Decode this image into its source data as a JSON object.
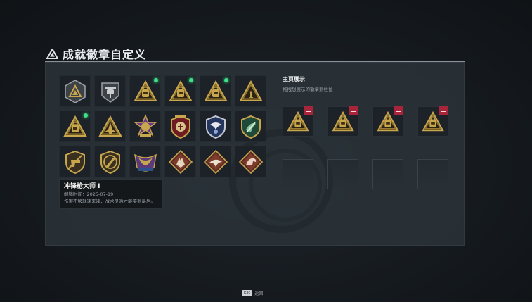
{
  "header": {
    "title": "成就徽章自定义"
  },
  "badges": [
    {
      "icon": "hexagon-triangle-badge-icon",
      "new": false
    },
    {
      "icon": "helicopter-badge-icon",
      "new": false
    },
    {
      "icon": "backpack-badge-icon",
      "new": true
    },
    {
      "icon": "backpack-badge-icon",
      "new": true
    },
    {
      "icon": "backpack-badge-icon",
      "new": true
    },
    {
      "icon": "number-one-badge-icon",
      "new": false
    },
    {
      "icon": "backpack-badge-icon",
      "new": true
    },
    {
      "icon": "fighter-jet-badge-icon",
      "new": false
    },
    {
      "icon": "star-cross-crest-icon",
      "new": false
    },
    {
      "icon": "red-shield-crest-icon",
      "new": false
    },
    {
      "icon": "blue-eagle-crest-icon",
      "new": false
    },
    {
      "icon": "green-shield-crest-icon",
      "new": false
    },
    {
      "icon": "no-pistol-shield-icon",
      "new": false
    },
    {
      "icon": "no-knife-shield-icon",
      "new": false
    },
    {
      "icon": "eagle-wings-crest-icon",
      "new": false
    },
    {
      "icon": "wolf-diamond-icon",
      "new": false
    },
    {
      "icon": "bird-diamond-icon",
      "new": false
    },
    {
      "icon": "dragon-diamond-icon",
      "new": false
    }
  ],
  "tooltip": {
    "name": "冲锋枪大师 I",
    "unlock": "解锁时间：2025-07-19",
    "desc": "伤害不够就速来凑，战术灵活才能笑到最后。"
  },
  "showcase": {
    "title": "主页展示",
    "subtitle": "拖拽想展示的徽章到栏位",
    "slots": [
      {
        "icon": "backpack-badge-icon",
        "filled": true
      },
      {
        "icon": "backpack-badge-icon",
        "filled": true
      },
      {
        "icon": "backpack-badge-icon",
        "filled": true
      },
      {
        "icon": "backpack-badge-icon",
        "filled": true
      },
      {
        "filled": false
      },
      {
        "filled": false
      },
      {
        "filled": false
      },
      {
        "filled": false
      }
    ]
  },
  "footer": {
    "key": "Esc",
    "action": "返回"
  },
  "colors": {
    "gold": "#c8a64e",
    "panel": "#2c343a",
    "new_dot": "#3ee08a",
    "remove": "#a8243a"
  }
}
